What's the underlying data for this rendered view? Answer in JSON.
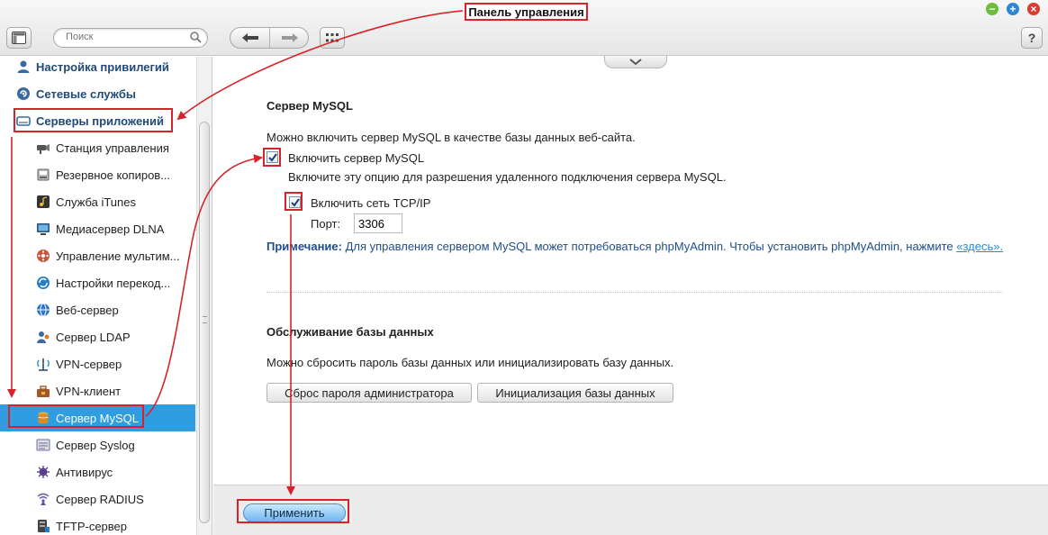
{
  "toolbar": {
    "search_placeholder": "Поиск",
    "help_label": "?",
    "window_controls": {
      "minimize": "−",
      "maximize": "+",
      "close": "×"
    },
    "colors": {
      "minimize": "#6fbd3c",
      "maximize": "#2f86d1",
      "close": "#db3a30"
    }
  },
  "sidebar": {
    "categories": [
      {
        "label": "Настройка привилегий",
        "icon": "user-icon"
      },
      {
        "label": "Сетевые службы",
        "icon": "network-services-icon"
      },
      {
        "label": "Серверы приложений",
        "icon": "app-servers-icon"
      }
    ],
    "items": [
      {
        "label": "Станция управления",
        "icon": "surveillance-icon"
      },
      {
        "label": "Резервное копиров...",
        "icon": "backup-icon"
      },
      {
        "label": "Служба iTunes",
        "icon": "itunes-icon"
      },
      {
        "label": "Медиасервер DLNA",
        "icon": "dlna-icon"
      },
      {
        "label": "Управление мультим...",
        "icon": "multimedia-icon"
      },
      {
        "label": "Настройки перекод...",
        "icon": "transcode-icon"
      },
      {
        "label": "Веб-сервер",
        "icon": "web-server-icon"
      },
      {
        "label": "Сервер LDAP",
        "icon": "ldap-icon"
      },
      {
        "label": "VPN-сервер",
        "icon": "vpn-server-icon"
      },
      {
        "label": "VPN-клиент",
        "icon": "vpn-client-icon"
      },
      {
        "label": "Сервер MySQL",
        "icon": "mysql-icon"
      },
      {
        "label": "Сервер Syslog",
        "icon": "syslog-icon"
      },
      {
        "label": "Антивирус",
        "icon": "antivirus-icon"
      },
      {
        "label": "Сервер RADIUS",
        "icon": "radius-icon"
      },
      {
        "label": "TFTP-сервер",
        "icon": "tftp-icon"
      }
    ],
    "active_item": "Сервер MySQL",
    "active_color": "#2e9ee0"
  },
  "mysql": {
    "title": "Сервер MySQL",
    "description": "Можно включить сервер MySQL в качестве базы данных веб-сайта.",
    "enable_label": "Включить сервер MySQL",
    "enable_checked": true,
    "enable_hint": "Включите эту опцию для разрешения удаленного подключения сервера MySQL.",
    "tcpip_label": "Включить сеть TCP/IP",
    "tcpip_checked": true,
    "port_label": "Порт:",
    "port_value": "3306",
    "note_prefix": "Примечание:",
    "note_text": " Для управления сервером MySQL может потребоваться phpMyAdmin. Чтобы установить phpMyAdmin, нажмите ",
    "note_link": "«здесь».",
    "note_color": "#1f4e8c"
  },
  "db_maintenance": {
    "title": "Обслуживание базы данных",
    "description": "Можно сбросить пароль базы данных или инициализировать базу данных.",
    "reset_button": "Сброс пароля администратора",
    "init_button": "Инициализация базы данных"
  },
  "footer": {
    "apply_button": "Применить"
  },
  "annotation": {
    "callout_label": "Панель управления",
    "color": "#d6232a"
  }
}
